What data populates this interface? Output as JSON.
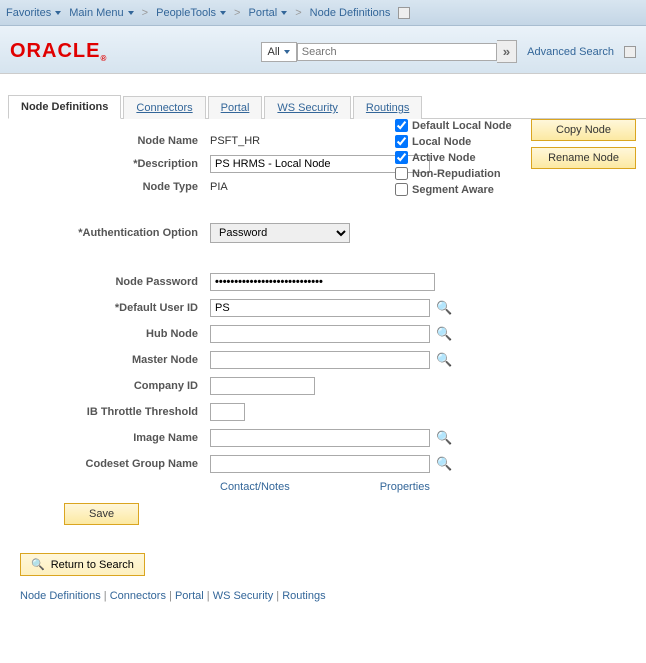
{
  "breadcrumbs": {
    "favorites": "Favorites",
    "main_menu": "Main Menu",
    "peopletools": "PeopleTools",
    "portal": "Portal",
    "node_defs": "Node Definitions"
  },
  "logo": {
    "text": "ORACLE",
    "tm": "®"
  },
  "search": {
    "all": "All",
    "placeholder": "Search",
    "advanced": "Advanced Search"
  },
  "tabs": {
    "node_defs": "Node Definitions",
    "connectors": "Connectors",
    "portal": "Portal",
    "ws_security": "WS Security",
    "routings": "Routings"
  },
  "buttons": {
    "copy": "Copy Node",
    "rename": "Rename Node",
    "save": "Save",
    "return": "Return to Search"
  },
  "fields": {
    "node_name_lbl": "Node Name",
    "node_name_val": "PSFT_HR",
    "description_lbl": "*Description",
    "description_val": "PS HRMS - Local Node",
    "node_type_lbl": "Node Type",
    "node_type_val": "PIA",
    "auth_lbl": "*Authentication Option",
    "auth_val": "Password",
    "pwd_lbl": "Node Password",
    "pwd_val": "••••••••••••••••••••••••••••",
    "user_lbl": "*Default User ID",
    "user_val": "PS",
    "hub_lbl": "Hub Node",
    "hub_val": "",
    "master_lbl": "Master Node",
    "master_val": "",
    "company_lbl": "Company ID",
    "company_val": "",
    "throttle_lbl": "IB Throttle Threshold",
    "throttle_val": "",
    "image_lbl": "Image Name",
    "image_val": "",
    "codeset_lbl": "Codeset Group Name",
    "codeset_val": ""
  },
  "checkboxes": {
    "default_local": "Default Local Node",
    "local": "Local Node",
    "active": "Active Node",
    "nonrep": "Non-Repudiation",
    "segment": "Segment Aware"
  },
  "links": {
    "contact": "Contact/Notes",
    "properties": "Properties"
  },
  "bottom": {
    "node_defs": "Node Definitions",
    "connectors": "Connectors",
    "portal": "Portal",
    "ws_security": "WS Security",
    "routings": "Routings"
  }
}
